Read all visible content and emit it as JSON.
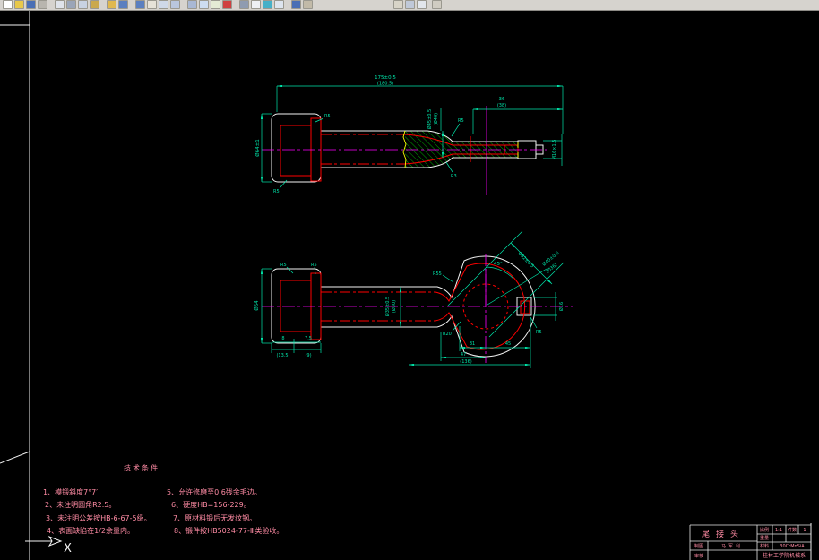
{
  "colors": {
    "canvas_bg": "#000000",
    "dimension": "#00e6aa",
    "outline": "#f2f2f2",
    "forging_line": "#ff0000",
    "hatch": "#00cc00",
    "centerline": "#ff00ff",
    "annotation_pink": "#ff8ba4",
    "toolbar_bg": "#d6d3ce"
  },
  "toolbar": {
    "icons": [
      {
        "name": "new-file-icon",
        "color": "#ffffff",
        "gap": 2
      },
      {
        "name": "open-icon",
        "color": "#e8c84a",
        "gap": 0
      },
      {
        "name": "save-icon",
        "color": "#4a6fb5",
        "gap": 0
      },
      {
        "name": "print-icon",
        "color": "#b8b5ae",
        "gap": 0
      },
      {
        "name": "preview-icon",
        "color": "#dfe3ea",
        "gap": 6
      },
      {
        "name": "cut-icon",
        "color": "#9aa5b8",
        "gap": 0
      },
      {
        "name": "copy-icon",
        "color": "#c8d2e2",
        "gap": 0
      },
      {
        "name": "paste-icon",
        "color": "#caa84c",
        "gap": 0
      },
      {
        "name": "match-props-icon",
        "color": "#e0b84e",
        "gap": 6
      },
      {
        "name": "undo-icon",
        "color": "#5a7fc0",
        "gap": 0
      },
      {
        "name": "redo-icon",
        "color": "#5a7fc0",
        "gap": 6
      },
      {
        "name": "pan-icon",
        "color": "#e6e2d8",
        "gap": 0
      },
      {
        "name": "zoom-realtime-icon",
        "color": "#cfd8e8",
        "gap": 0
      },
      {
        "name": "zoom-window-icon",
        "color": "#b9c6dd",
        "gap": 0
      },
      {
        "name": "zoom-previous-icon",
        "color": "#a9b8d4",
        "gap": 6
      },
      {
        "name": "layers-icon",
        "color": "#cddcf0",
        "gap": 0
      },
      {
        "name": "layer-properties-icon",
        "color": "#e4ead4",
        "gap": 0
      },
      {
        "name": "color-control-icon",
        "color": "#d04040",
        "gap": 0
      },
      {
        "name": "linetype-icon",
        "color": "#8f9bb0",
        "gap": 6
      },
      {
        "name": "text-style-icon",
        "color": "#eef0f4",
        "gap": 0
      },
      {
        "name": "dim-style-icon",
        "color": "#46b0c8",
        "gap": 0
      },
      {
        "name": "table-icon",
        "color": "#dde4ee",
        "gap": 0
      },
      {
        "name": "properties-icon",
        "color": "#4a6fb5",
        "gap": 6
      },
      {
        "name": "toolbox-icon",
        "color": "#c2baa8",
        "gap": 0
      },
      {
        "name": "osnap-icon",
        "color": "#d8d4c8",
        "gap": 88
      },
      {
        "name": "model-tab-icon",
        "color": "#bfc8d8",
        "gap": 0
      },
      {
        "name": "layout-icon",
        "color": "#e2e6ec",
        "gap": 0
      },
      {
        "name": "help-icon",
        "color": "#d0ccc2",
        "gap": 4
      }
    ]
  },
  "notes": {
    "title": "技术条件",
    "col1": [
      "1、模锻斜度7°7′",
      "2、未注明圆角R2.5。",
      "3、未注明公差按HB-6-67-5级。",
      "4、表面缺陷在1/2余量内。"
    ],
    "col2": [
      "5、允许修磨至0.6残余毛边。",
      "6、硬度HB=156-229。",
      "7、原材料锻后无发纹钢。",
      "8、锻件按HB5024-77-Ⅲ类验收。"
    ]
  },
  "dims_top": {
    "overall": "175±0.5",
    "overall_ref": "(180.5)",
    "len36": "36",
    "len36_ref": "(38)",
    "dia_head": "Ø64±1",
    "dia_mid": "Ø45±0.5",
    "dia_mid_ref": "(Ø40)",
    "thread": "M16×1.5",
    "r5": "R5",
    "r3": "R3"
  },
  "dims_bottom": {
    "width_head": "Ø64",
    "d8": "8",
    "d8_ref": "(13.5)",
    "d75": "7.5",
    "d75_ref": "(9)",
    "dia35": "Ø35±0.5",
    "dia35_ref": "(Ø30)",
    "angle": "45°",
    "diag": "Ø62±0.5",
    "hole": "Ø40±0.5",
    "hole_ref": "(Ø36)",
    "r55": "R55",
    "r20": "R20",
    "r5": "R5",
    "d31": "31",
    "d45": "45",
    "d47": "47",
    "d136": "(136)",
    "dia16": "Ø16"
  },
  "ucs": {
    "x_label": "X"
  },
  "title_block": {
    "part_name": "尾接头",
    "drawn_label": "制图",
    "drawn_by": "马军利",
    "checked_label": "审核",
    "scale_label": "比例",
    "scale": "1:1",
    "qty_label": "件数",
    "qty": "1",
    "weight_label": "重量",
    "weight": "",
    "material_label": "材料",
    "material": "30CrMnSiA",
    "org": "桂林工学院机械系"
  }
}
